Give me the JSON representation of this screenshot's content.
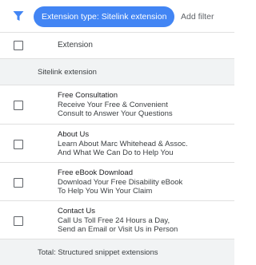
{
  "filter_bar": {
    "filter_icon": "filter-funnel-icon",
    "chip_label": "Extension type: Sitelink extension",
    "add_filter_label": "Add filter",
    "accent_color": "#4285f4"
  },
  "table": {
    "column_header": "Extension",
    "group_label": "Sitelink extension",
    "rows": [
      {
        "title": "Free Consultation",
        "line1": "Receive Your Free & Convenient",
        "line2": "Consult to Answer Your Questions"
      },
      {
        "title": "About Us",
        "line1": "Learn About Marc Whitehead & Assoc.",
        "line2": "And What We Can Do to Help You"
      },
      {
        "title": "Free eBook Download",
        "line1": "Download Your Free Disability eBook",
        "line2": "To Help You Win Your Claim"
      },
      {
        "title": "Contact Us",
        "line1": "Call Us Toll Free 24 Hours a Day,",
        "line2": "Send an Email or Visit Us in Person"
      }
    ],
    "total_label": "Total: Structured snippet extensions"
  }
}
